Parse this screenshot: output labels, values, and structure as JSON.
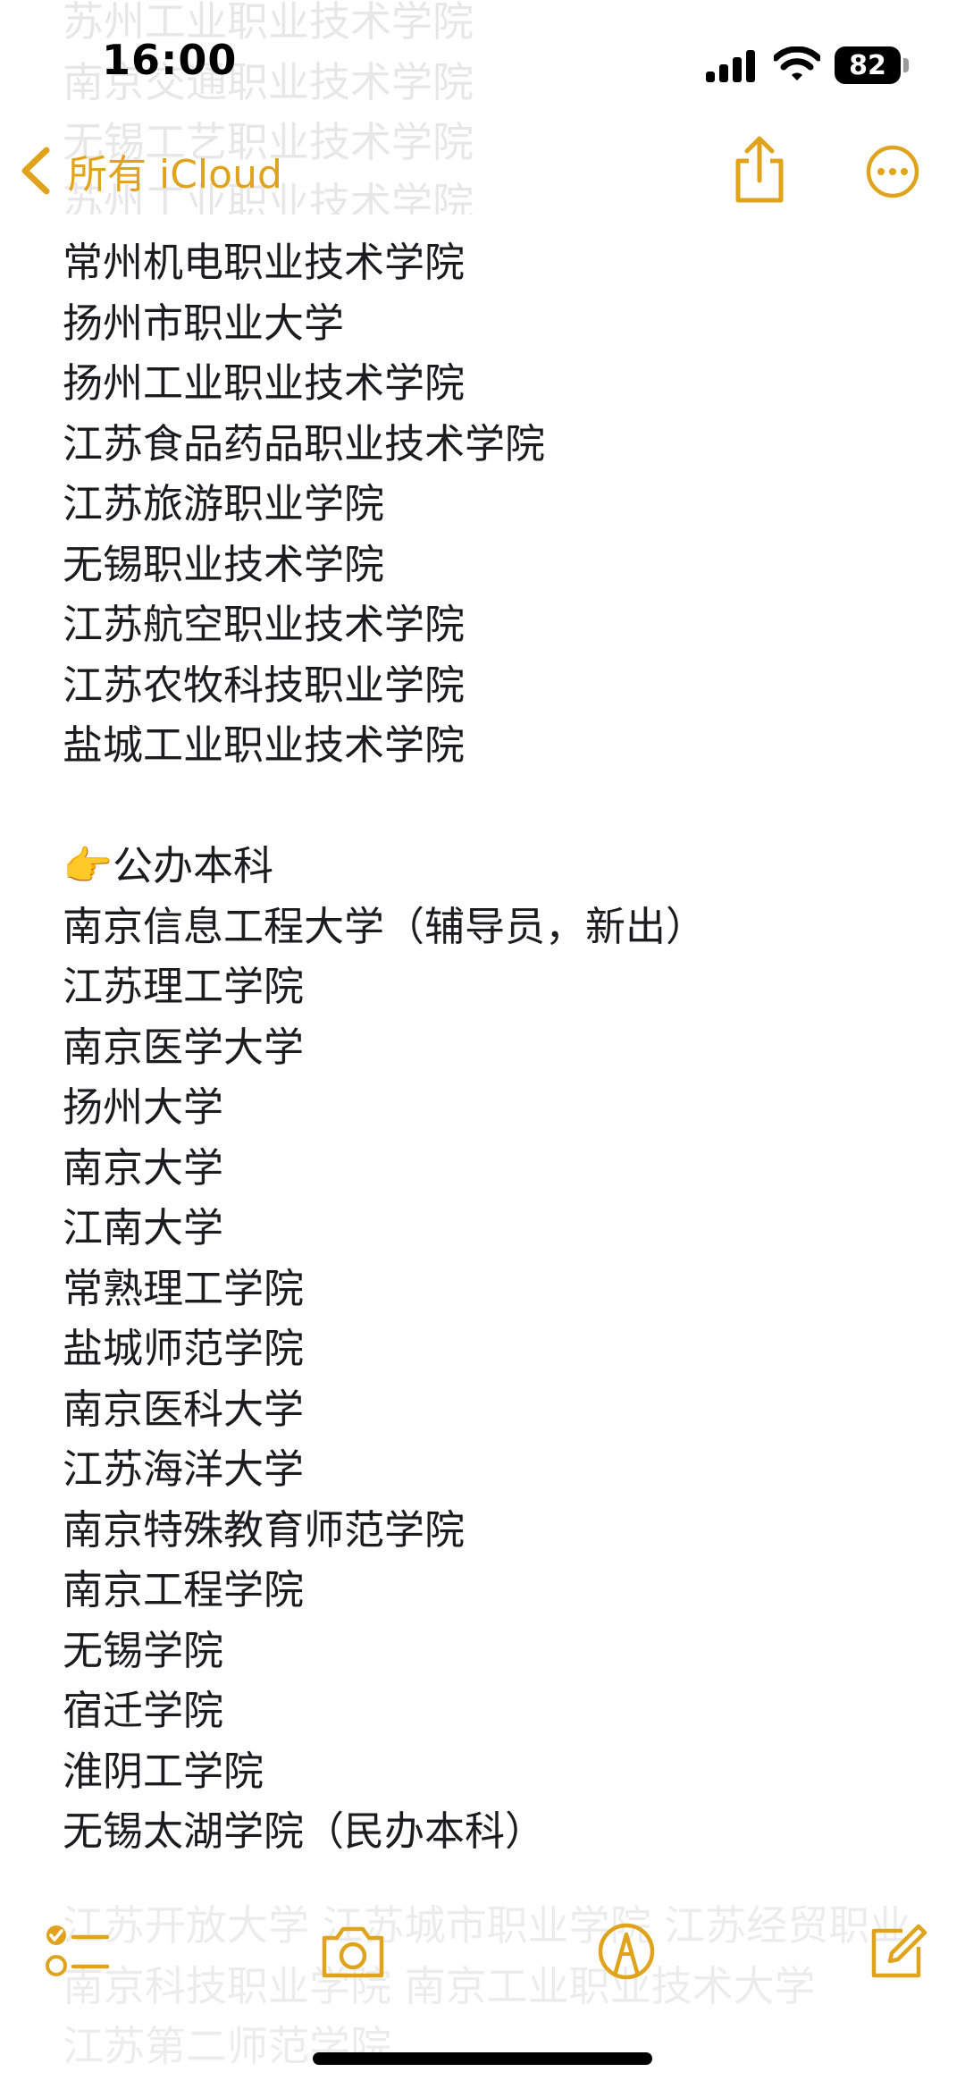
{
  "status_bar": {
    "time": "16:00",
    "battery_level": "82"
  },
  "nav": {
    "back_label": "所有 iCloud",
    "share_icon": "share-icon",
    "more_icon": "ellipsis-circle-icon"
  },
  "ghost_top": {
    "lines": [
      "苏州工业职业技术学院",
      "南京交通职业技术学院",
      "无锡工艺职业技术学院",
      "苏州工业职业技术学院"
    ]
  },
  "note": {
    "lines_a": [
      "常州机电职业技术学院",
      "扬州市职业大学",
      "扬州工业职业技术学院",
      "江苏食品药品职业技术学院",
      "江苏旅游职业学院",
      "无锡职业技术学院",
      "江苏航空职业技术学院",
      "江苏农牧科技职业学院",
      "盐城工业职业技术学院"
    ],
    "section_emoji": "👉",
    "section_heading": "公办本科",
    "lines_b": [
      "南京信息工程大学（辅导员，新出）",
      "江苏理工学院",
      "南京医学大学",
      "扬州大学",
      "南京大学",
      "江南大学",
      "常熟理工学院",
      "盐城师范学院",
      "南京医科大学",
      "江苏海洋大学",
      "南京特殊教育师范学院",
      "南京工程学院",
      "无锡学院",
      "宿迁学院",
      "淮阴工学院",
      "无锡太湖学院（民办本科）"
    ]
  },
  "ghost_bottom": {
    "lines": [
      "江苏开放大学 江苏城市职业学院 江苏经贸职业",
      "南京科技职业学院 南京工业职业技术大学",
      "江苏第二师范学院"
    ]
  },
  "toolbar": {
    "checklist_icon": "checklist-icon",
    "camera_icon": "camera-icon",
    "markup_icon": "markup-pen-icon",
    "compose_icon": "compose-icon"
  },
  "colors": {
    "accent": "#e0a31c",
    "text": "#1c1c1e",
    "background": "#ffffff"
  }
}
